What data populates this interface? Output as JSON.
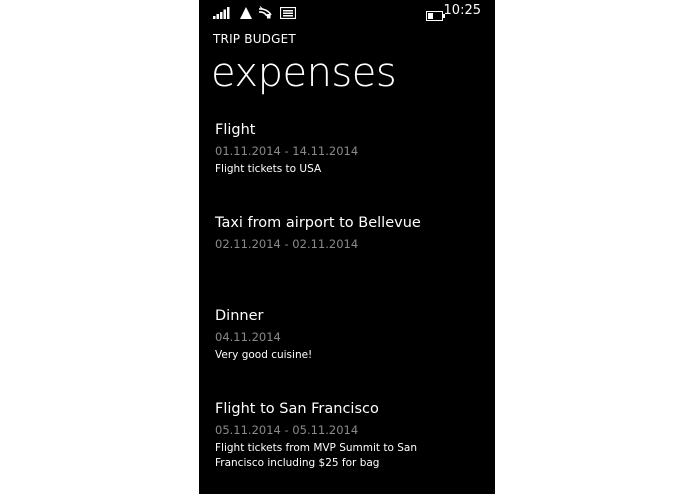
{
  "status_bar": {
    "time": "10:25",
    "icons": [
      "signal-strength-icon",
      "data-network-icon",
      "wifi-icon",
      "message-icon",
      "battery-icon"
    ]
  },
  "app_title": "TRIP BUDGET",
  "page_title": "expenses",
  "expenses": [
    {
      "title": "Flight",
      "dates": "01.11.2014 - 14.11.2014",
      "description": "Flight tickets to USA"
    },
    {
      "title": "Taxi from airport to Bellevue",
      "dates": "02.11.2014 - 02.11.2014",
      "description": ""
    },
    {
      "title": "Dinner",
      "dates": "04.11.2014",
      "description": "Very good cuisine!"
    },
    {
      "title": "Flight to San Francisco",
      "dates": "05.11.2014 - 05.11.2014",
      "description": "Flight tickets from MVP Summit to San Francisco including $25 for bag"
    }
  ],
  "colors": {
    "background": "#000000",
    "text": "#ffffff",
    "secondary_text": "#8a8a8a"
  }
}
